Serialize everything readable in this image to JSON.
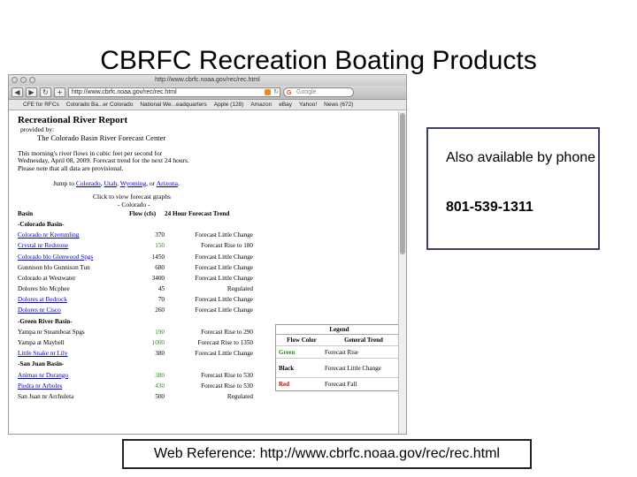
{
  "slide": {
    "title": "CBRFC Recreation Boating Products",
    "callout": {
      "text": "Also available by phone",
      "phone": "801-539-1311"
    },
    "web_reference": "Web Reference:  http://www.cbrfc.noaa.gov/rec/rec.html"
  },
  "browser": {
    "window_title": "http://www.cbrfc.noaa.gov/rec/rec.html",
    "address": "http://www.cbrfc.noaa.gov/rec/rec.html",
    "search_placeholder": "Google",
    "bookmarks": [
      "CFE for RFCs",
      "Colorado Ba...er Colorado",
      "National We...eadquarters",
      "Apple (128)",
      "Amazon",
      "eBay",
      "Yahoo!",
      "News (672)"
    ]
  },
  "page": {
    "report_title": "Recreational River Report",
    "provided_by": "provided by:",
    "provider": "The Colorado Basin River Forecast Center",
    "paragraph_1": "This morning's river flows in cubic feet per second for",
    "paragraph_2": "Wednesday, April 08, 2009. Forecast trend for the next 24 hours.",
    "paragraph_3": "Please note that all data are provisional.",
    "jump_label": "Jump to",
    "jump_links": [
      "Colorado",
      "Utah",
      "Wyoming",
      "Arizona"
    ],
    "click_view": "Click to view forecast graphs",
    "section_label": "- Colorado -",
    "table_headers": [
      "Basin",
      "Flow (cfs)",
      "24 Hour Forecast Trend"
    ],
    "rows": [
      {
        "name": "-Colorado Basin-",
        "flow": "",
        "trend": "",
        "group": true
      },
      {
        "name": "Colorado nr Kremmling",
        "flow": "370",
        "trend": "Forecast Little Change",
        "link": true
      },
      {
        "name": "Crystal nr Redstone",
        "flow": "150",
        "trend": "Forecast Rise to 180",
        "link": true,
        "color": "green"
      },
      {
        "name": "Colorado blo Glenwood Spgs",
        "flow": "1450",
        "trend": "Forecast Little Change",
        "link": true
      },
      {
        "name": "Gunnison blo Gunnison Tun",
        "flow": "680",
        "trend": "Forecast Little Change"
      },
      {
        "name": "Colorado at Westwater",
        "flow": "3400",
        "trend": "Forecast Little Change"
      },
      {
        "name": "Dolores blo Mcphee",
        "flow": "45",
        "trend": "Regulated"
      },
      {
        "name": "Dolores at Bedrock",
        "flow": "70",
        "trend": "Forecast Little Change",
        "link": true
      },
      {
        "name": "Dolores nr Cisco",
        "flow": "260",
        "trend": "Forecast Little Change",
        "link": true
      },
      {
        "name": "-Green River Basin-",
        "flow": "",
        "trend": "",
        "group": true
      },
      {
        "name": "Yampa nr Steamboat Spgs",
        "flow": "190",
        "trend": "Forecast Rise to 290",
        "color": "green"
      },
      {
        "name": "Yampa at Maybell",
        "flow": "1000",
        "trend": "Forecast Rise to 1350",
        "color": "green"
      },
      {
        "name": "Little Snake nr Lily",
        "flow": "380",
        "trend": "Forecast Little Change",
        "link": true
      },
      {
        "name": "-San Juan Basin-",
        "flow": "",
        "trend": "",
        "group": true
      },
      {
        "name": "Animas nr Durango",
        "flow": "380",
        "trend": "Forecast Rise to 530",
        "link": true,
        "color": "green"
      },
      {
        "name": "Piedra nr Arboles",
        "flow": "430",
        "trend": "Forecast Rise to 530",
        "link": true,
        "color": "green"
      },
      {
        "name": "San Juan nr Archuleta",
        "flow": "500",
        "trend": "Regulated"
      }
    ],
    "legend": {
      "title": "Legend",
      "headers": [
        "Flow Color",
        "General Trend"
      ],
      "rows": [
        {
          "color_name": "Green",
          "trend": "Forecast Rise",
          "color": "green"
        },
        {
          "color_name": "Black",
          "trend": "Forecast Little Change",
          "color": "black"
        },
        {
          "color_name": "Red",
          "trend": "Forecast Fall",
          "color": "red"
        }
      ]
    }
  },
  "colors": {
    "link": "#0000cc",
    "green": "#2a8a1a",
    "red": "#cc0000",
    "callout_border": "#3b3f6b"
  }
}
